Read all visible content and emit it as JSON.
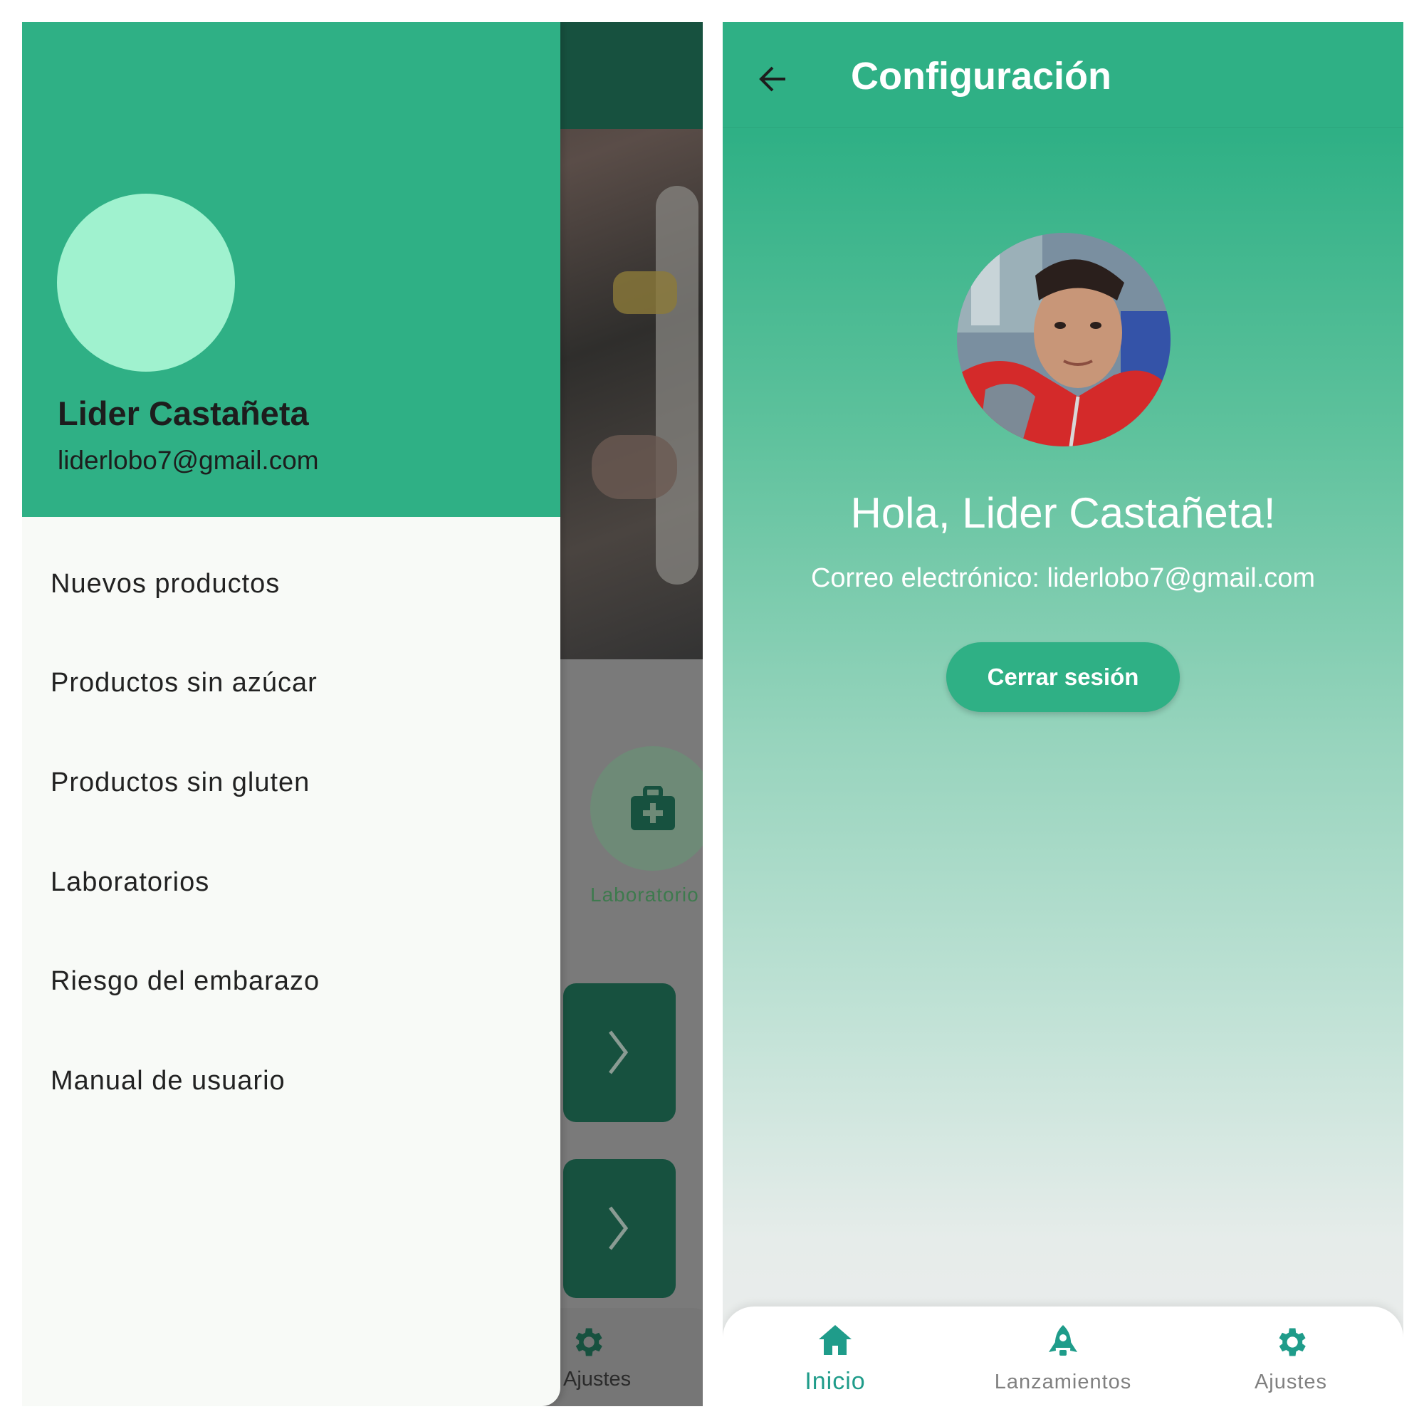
{
  "left": {
    "background": {
      "category_label": "Laboratorio",
      "nav_label": "Ajustes"
    },
    "drawer": {
      "user_name": "Lider Castañeta",
      "user_email": "liderlobo7@gmail.com",
      "items": [
        {
          "label": "Nuevos productos"
        },
        {
          "label": "Productos sin azúcar"
        },
        {
          "label": "Productos sin gluten"
        },
        {
          "label": "Laboratorios"
        },
        {
          "label": "Riesgo del embarazo"
        },
        {
          "label": "Manual de usuario"
        }
      ]
    }
  },
  "right": {
    "header": {
      "title": "Configuración",
      "back_icon": "arrow-back-icon"
    },
    "profile": {
      "greeting": "Hola, Lider Castañeta!",
      "email_line": "Correo electrónico: liderlobo7@gmail.com",
      "logout_label": "Cerrar sesión"
    },
    "bottom_nav": {
      "items": [
        {
          "label": "Inicio",
          "icon": "home-icon",
          "active": true
        },
        {
          "label": "Lanzamientos",
          "icon": "rocket-icon",
          "active": false
        },
        {
          "label": "Ajustes",
          "icon": "gear-icon",
          "active": false
        }
      ]
    }
  },
  "colors": {
    "primary": "#2fb085",
    "primary_dark": "#17513f",
    "avatar_placeholder": "#a0f2cf",
    "nav_active": "#1f9c8a",
    "nav_inactive": "#808080"
  }
}
